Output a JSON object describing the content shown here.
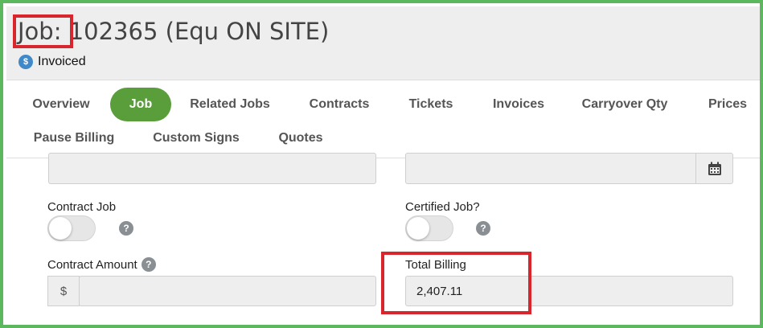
{
  "header": {
    "job_label": "Job:",
    "job_title": "102365 (Equ ON SITE)",
    "status_icon": "$",
    "status_text": "Invoiced"
  },
  "tabs": [
    {
      "label": "Overview",
      "active": false
    },
    {
      "label": "Job",
      "active": true
    },
    {
      "label": "Related Jobs",
      "active": false
    },
    {
      "label": "Contracts",
      "active": false
    },
    {
      "label": "Tickets",
      "active": false
    },
    {
      "label": "Invoices",
      "active": false
    },
    {
      "label": "Carryover Qty",
      "active": false
    },
    {
      "label": "Prices",
      "active": false
    },
    {
      "label": "Pause Billing",
      "active": false
    },
    {
      "label": "Custom Signs",
      "active": false
    },
    {
      "label": "Quotes",
      "active": false
    }
  ],
  "form": {
    "contract_job_label": "Contract Job",
    "certified_job_label": "Certified Job?",
    "help_glyph": "?",
    "contract_amount_label": "Contract Amount",
    "currency_symbol": "$",
    "contract_amount_value": "",
    "total_billing_label": "Total Billing",
    "total_billing_value": "2,407.11"
  },
  "colors": {
    "frame_border": "#5cb85c",
    "active_tab": "#5a9e3c",
    "highlight": "#d9262c",
    "status_icon": "#3f89c9"
  }
}
